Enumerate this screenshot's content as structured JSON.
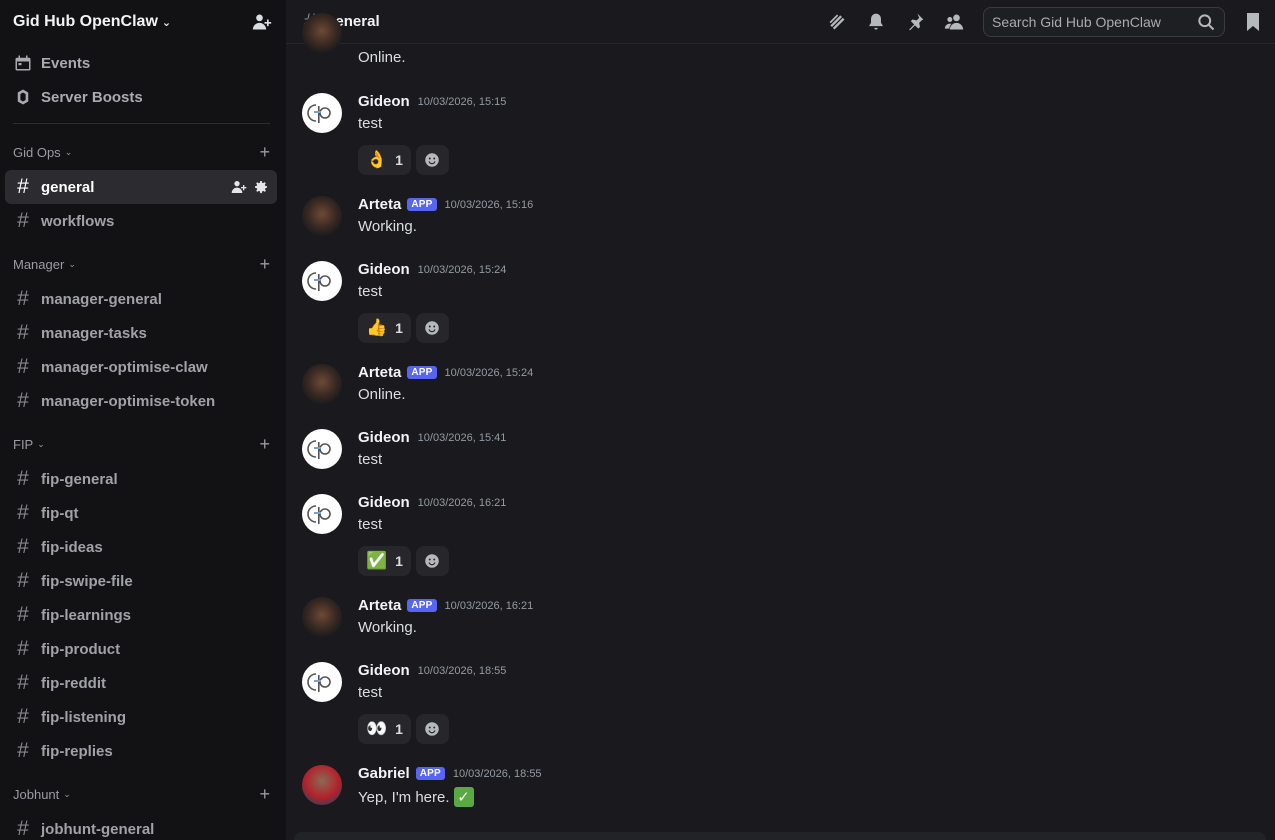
{
  "server": {
    "name": "Gid Hub OpenClaw"
  },
  "top_items": [
    {
      "label": "Events",
      "icon": "calendar-icon"
    },
    {
      "label": "Server Boosts",
      "icon": "boost-icon"
    }
  ],
  "categories": [
    {
      "name": "Gid Ops",
      "channels": [
        "general",
        "workflows"
      ]
    },
    {
      "name": "Manager",
      "channels": [
        "manager-general",
        "manager-tasks",
        "manager-optimise-claw",
        "manager-optimise-token"
      ]
    },
    {
      "name": "FIP",
      "channels": [
        "fip-general",
        "fip-qt",
        "fip-ideas",
        "fip-swipe-file",
        "fip-learnings",
        "fip-product",
        "fip-reddit",
        "fip-listening",
        "fip-replies"
      ]
    },
    {
      "name": "Jobhunt",
      "channels": [
        "jobhunt-general"
      ]
    }
  ],
  "active_channel": "general",
  "header": {
    "channel_name": "general",
    "search_placeholder": "Search Gid Hub OpenClaw"
  },
  "messages": [
    {
      "author": "",
      "badge": "",
      "time": "",
      "text": "Online.",
      "avatar": "arteta",
      "reactions": []
    },
    {
      "author": "Gideon",
      "badge": "",
      "time": "10/03/2026, 15:15",
      "text": "test",
      "avatar": "gideon",
      "reactions": [
        {
          "emoji": "👌",
          "count": "1"
        }
      ]
    },
    {
      "author": "Arteta",
      "badge": "APP",
      "time": "10/03/2026, 15:16",
      "text": "Working.",
      "avatar": "arteta",
      "reactions": []
    },
    {
      "author": "Gideon",
      "badge": "",
      "time": "10/03/2026, 15:24",
      "text": "test",
      "avatar": "gideon",
      "reactions": [
        {
          "emoji": "👍",
          "count": "1"
        }
      ]
    },
    {
      "author": "Arteta",
      "badge": "APP",
      "time": "10/03/2026, 15:24",
      "text": "Online.",
      "avatar": "arteta",
      "reactions": []
    },
    {
      "author": "Gideon",
      "badge": "",
      "time": "10/03/2026, 15:41",
      "text": "test",
      "avatar": "gideon",
      "reactions": []
    },
    {
      "author": "Gideon",
      "badge": "",
      "time": "10/03/2026, 16:21",
      "text": "test",
      "avatar": "gideon",
      "reactions": [
        {
          "emoji": "✅",
          "count": "1"
        }
      ]
    },
    {
      "author": "Arteta",
      "badge": "APP",
      "time": "10/03/2026, 16:21",
      "text": "Working.",
      "avatar": "arteta",
      "reactions": []
    },
    {
      "author": "Gideon",
      "badge": "",
      "time": "10/03/2026, 18:55",
      "text": "test",
      "avatar": "gideon",
      "reactions": [
        {
          "emoji": "👀",
          "count": "1"
        }
      ]
    },
    {
      "author": "Gabriel",
      "badge": "APP",
      "time": "10/03/2026, 18:55",
      "text": "Yep, I'm here.",
      "avatar": "gabriel",
      "reactions": []
    }
  ],
  "colors": {
    "accent": "#5865f2",
    "sidebar_bg": "#121214",
    "main_bg": "#1a1a1e"
  }
}
